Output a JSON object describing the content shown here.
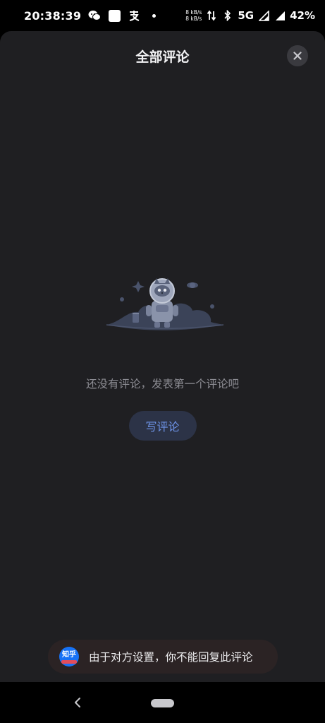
{
  "status_bar": {
    "time": "20:38:39",
    "net_speed_up": "8 kB/s",
    "net_speed_down": "8 kB/s",
    "network_type": "5G",
    "battery": "42%",
    "icons": [
      "wechat-icon",
      "app-square-icon",
      "alipay-icon",
      "notification-dot-icon",
      "data-arrows-icon",
      "bluetooth-icon",
      "signal-icon",
      "signal-icon-2"
    ]
  },
  "sheet": {
    "title": "全部评论",
    "close_icon": "close-icon"
  },
  "empty_state": {
    "illustration": "robot-astronaut-illustration",
    "message": "还没有评论，发表第一个评论吧",
    "write_button_label": "写评论"
  },
  "toast": {
    "app_icon_text": "知乎",
    "message": "由于对方设置，你不能回复此评论"
  },
  "nav_bar": {
    "back_icon": "back-chevron-icon",
    "home_icon": "home-pill-icon"
  },
  "colors": {
    "sheet_background": "#1f1f22",
    "accent": "#6e94e8",
    "toast_background": "#2b2324",
    "app_brand": "#1772f6"
  }
}
